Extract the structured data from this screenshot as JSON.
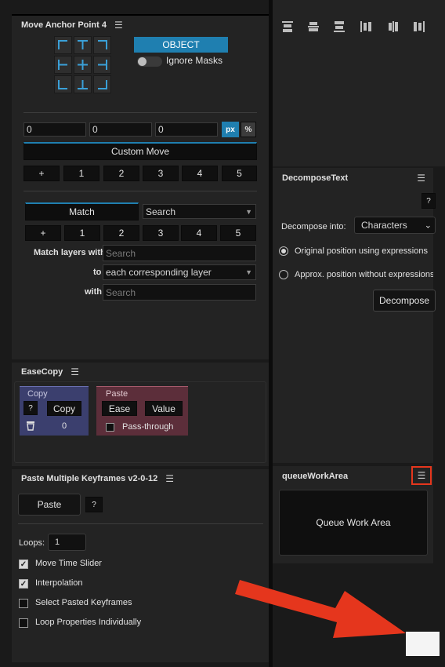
{
  "anchor_panel": {
    "title": "Move Anchor Point 4",
    "object_button": "OBJECT",
    "ignore_masks_label": "Ignore Masks",
    "x_value": "0",
    "y_value": "0",
    "z_value": "0",
    "unit_px": "px",
    "unit_pct": "%",
    "custom_move_label": "Custom Move",
    "move_buttons": [
      "+",
      "1",
      "2",
      "3",
      "4",
      "5"
    ],
    "match_tab": "Match",
    "search_tab": "Search",
    "match_buttons": [
      "+",
      "1",
      "2",
      "3",
      "4",
      "5"
    ],
    "match_layers_label": "Match layers with",
    "match_layers_placeholder": "Search",
    "to_label": "to",
    "to_value": "each corresponding layer",
    "with_label": "with",
    "with_placeholder": "Search"
  },
  "decompose_panel": {
    "title": "DecomposeText",
    "help": "?",
    "decompose_into_label": "Decompose into:",
    "decompose_into_value": "Characters",
    "option_1": "Original position using expressions",
    "option_2": "Approx. position without expressions",
    "decompose_button": "Decompose"
  },
  "easecopy_panel": {
    "title": "EaseCopy",
    "copy_group": "Copy",
    "help": "?",
    "copy_button": "Copy",
    "count": "0",
    "paste_group": "Paste",
    "ease_button": "Ease",
    "value_button": "Value",
    "pass_through_label": "Pass-through",
    "copy_color": "#3b3f6e",
    "paste_color": "#5c2e3a"
  },
  "queue_panel": {
    "title": "queueWorkArea",
    "button": "Queue Work Area"
  },
  "keyframes_panel": {
    "title": "Paste Multiple Keyframes v2-0-12",
    "paste_button": "Paste",
    "help": "?",
    "loops_label": "Loops:",
    "loops_value": "1",
    "options": [
      {
        "label": "Move Time Slider",
        "checked": true
      },
      {
        "label": "Interpolation",
        "checked": true
      },
      {
        "label": "Select Pasted Keyframes",
        "checked": false
      },
      {
        "label": "Loop Properties Individually",
        "checked": false
      }
    ]
  },
  "colors": {
    "accent": "#1f7fb0",
    "highlight": "#e5361d"
  }
}
